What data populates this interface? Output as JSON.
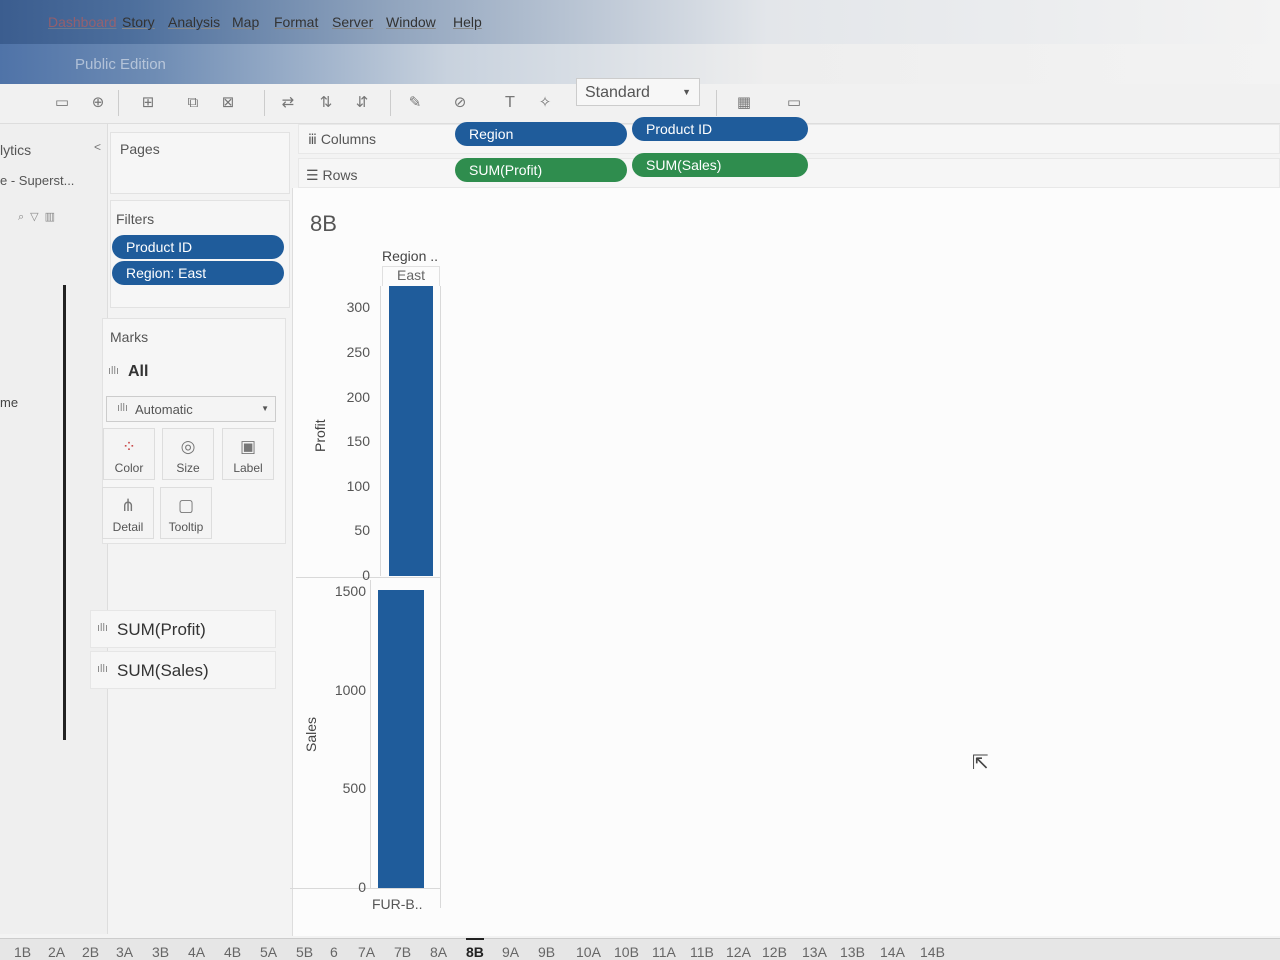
{
  "menu": {
    "dashboard": "Dashboard",
    "items": [
      "Story",
      "Analysis",
      "Map",
      "Format",
      "Server",
      "Window",
      "Help"
    ]
  },
  "edition": "Public Edition",
  "toolbar": {
    "fit": "Standard"
  },
  "data_pane": {
    "title": "lytics",
    "source": "e - Superst...",
    "field": "me"
  },
  "pages": {
    "title": "Pages"
  },
  "filters": {
    "title": "Filters",
    "items": [
      "Product ID",
      "Region: East"
    ]
  },
  "marks": {
    "title": "Marks",
    "all": "All",
    "type": "Automatic",
    "buttons": [
      "Color",
      "Size",
      "Label",
      "Detail",
      "Tooltip"
    ],
    "measures": [
      "SUM(Profit)",
      "SUM(Sales)"
    ]
  },
  "columns": {
    "label": "Columns",
    "pills": [
      "Region",
      "Product ID"
    ]
  },
  "rows": {
    "label": "Rows",
    "pills": [
      "SUM(Profit)",
      "SUM(Sales)"
    ]
  },
  "sheet": {
    "title": "8B",
    "header_title": "Region ..",
    "header_value": "East",
    "footer_label": "FUR-B.."
  },
  "colors": {
    "pill_blue": "#1f5c9b",
    "pill_green": "#2f8d4e",
    "bar": "#1f5c9b"
  },
  "chart_data": [
    {
      "type": "bar",
      "categories": [
        "FUR-B.."
      ],
      "values": [
        325
      ],
      "ylabel": "Profit",
      "ylim": [
        0,
        325
      ],
      "yticks": [
        0,
        50,
        100,
        150,
        200,
        250,
        300
      ]
    },
    {
      "type": "bar",
      "categories": [
        "FUR-B.."
      ],
      "values": [
        1510
      ],
      "ylabel": "Sales",
      "ylim": [
        0,
        1560
      ],
      "yticks": [
        0,
        500,
        1000,
        1500
      ]
    }
  ],
  "tabs": [
    "1B",
    "2A",
    "2B",
    "3A",
    "3B",
    "4A",
    "4B",
    "5A",
    "5B",
    "6",
    "7A",
    "7B",
    "8A",
    "8B",
    "9A",
    "9B",
    "10A",
    "10B",
    "11A",
    "11B",
    "12A",
    "12B",
    "13A",
    "13B",
    "14A",
    "14B"
  ],
  "active_tab": "8B"
}
